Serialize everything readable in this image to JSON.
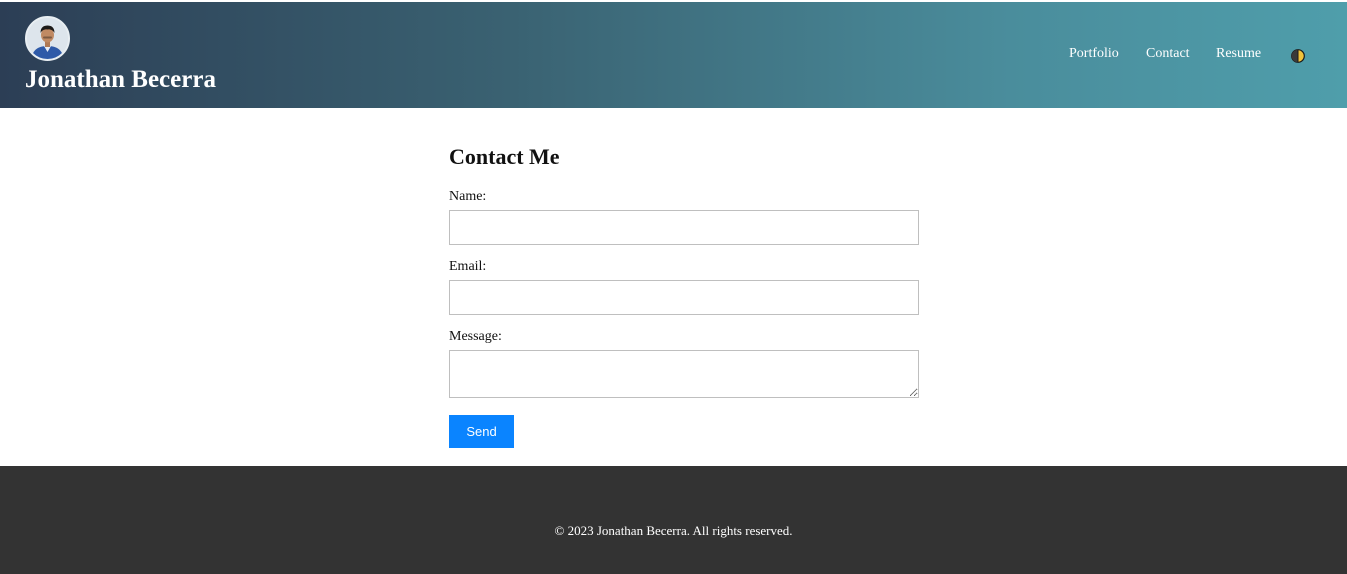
{
  "header": {
    "name": "Jonathan Becerra",
    "nav": [
      {
        "label": "Portfolio"
      },
      {
        "label": "Contact"
      },
      {
        "label": "Resume"
      }
    ],
    "theme_toggle_icon": "half-moon-icon",
    "gradient_colors": [
      "#2c3e55",
      "#4f9eab"
    ]
  },
  "form": {
    "title": "Contact Me",
    "name_label": "Name:",
    "name_value": "",
    "email_label": "Email:",
    "email_value": "",
    "message_label": "Message:",
    "message_value": "",
    "send_label": "Send",
    "send_color": "#0a84ff"
  },
  "footer": {
    "text": "© 2023 Jonathan Becerra. All rights reserved.",
    "background": "#333333"
  }
}
